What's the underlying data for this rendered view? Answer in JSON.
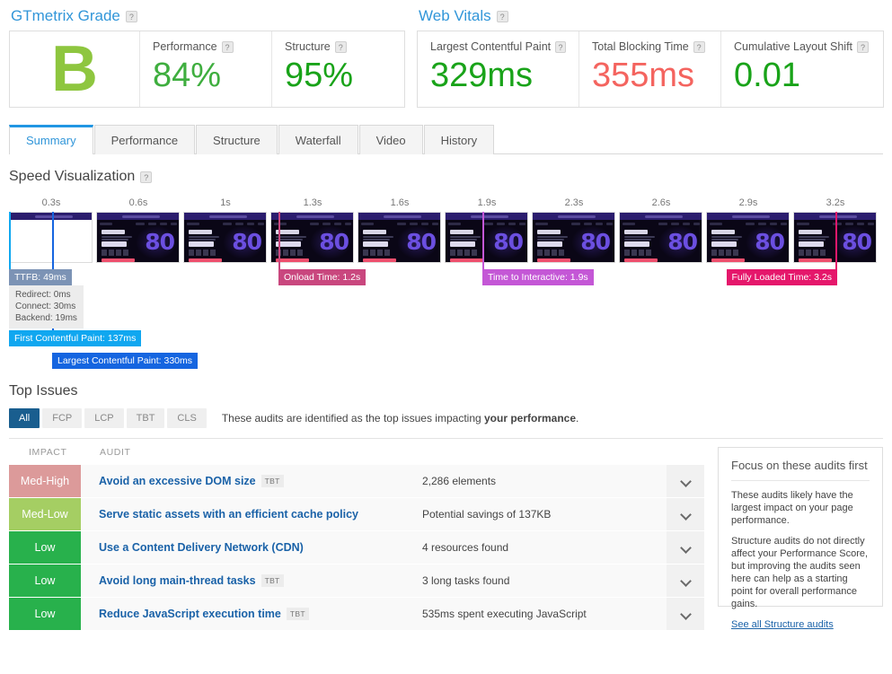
{
  "grade_panel": {
    "title": "GTmetrix Grade",
    "help_icon": "help-icon",
    "grade": "B",
    "grade_color": "#8ec63f",
    "metrics": [
      {
        "label": "Performance",
        "value": "84%",
        "color": "#3fae3f"
      },
      {
        "label": "Structure",
        "value": "95%",
        "color": "#19a319"
      }
    ]
  },
  "web_vitals": {
    "title": "Web Vitals",
    "metrics": [
      {
        "label": "Largest Contentful Paint",
        "value": "329ms",
        "color": "#19a319"
      },
      {
        "label": "Total Blocking Time",
        "value": "355ms",
        "color": "#f4645f"
      },
      {
        "label": "Cumulative Layout Shift",
        "value": "0.01",
        "color": "#19a319"
      }
    ]
  },
  "tabs": [
    {
      "label": "Summary",
      "active": true
    },
    {
      "label": "Performance",
      "active": false
    },
    {
      "label": "Structure",
      "active": false
    },
    {
      "label": "Waterfall",
      "active": false
    },
    {
      "label": "Video",
      "active": false
    },
    {
      "label": "History",
      "active": false
    }
  ],
  "speed_visualization": {
    "title": "Speed Visualization",
    "tick_labels": [
      "0.3s",
      "0.6s",
      "1s",
      "1.3s",
      "1.6s",
      "1.9s",
      "2.3s",
      "2.6s",
      "2.9s",
      "3.2s"
    ],
    "frames": [
      {
        "blank": true
      },
      {
        "blank": false
      },
      {
        "blank": false
      },
      {
        "blank": false
      },
      {
        "blank": false
      },
      {
        "blank": false
      },
      {
        "blank": false
      },
      {
        "blank": false
      },
      {
        "blank": false
      },
      {
        "blank": false
      }
    ],
    "thumbnail_text": "80",
    "markers": [
      {
        "name": "ttfb",
        "label": "TTFB: 49ms",
        "color": "#7c93b5"
      },
      {
        "name": "first-contentful-paint",
        "label": "First Contentful Paint: 137ms",
        "color": "#10a7f0"
      },
      {
        "name": "largest-contentful-paint",
        "label": "Largest Contentful Paint: 330ms",
        "color": "#1565e0"
      },
      {
        "name": "onload",
        "label": "Onload Time: 1.2s",
        "color": "#c9477e"
      },
      {
        "name": "time-to-interactive",
        "label": "Time to Interactive: 1.9s",
        "color": "#c457d6"
      },
      {
        "name": "fully-loaded",
        "label": "Fully Loaded Time: 3.2s",
        "color": "#e5176b"
      }
    ],
    "ttfb_breakdown": [
      "Redirect: 0ms",
      "Connect: 30ms",
      "Backend: 19ms"
    ]
  },
  "top_issues": {
    "title": "Top Issues",
    "filters": [
      {
        "label": "All",
        "active": true
      },
      {
        "label": "FCP",
        "active": false
      },
      {
        "label": "LCP",
        "active": false
      },
      {
        "label": "TBT",
        "active": false
      },
      {
        "label": "CLS",
        "active": false
      }
    ],
    "note_prefix": "These audits are identified as the top issues impacting ",
    "note_bold": "your performance",
    "note_suffix": ".",
    "columns": {
      "impact": "IMPACT",
      "audit": "AUDIT"
    },
    "rows": [
      {
        "impact": "Med-High",
        "impact_color": "#dc9a9a",
        "audit": "Avoid an excessive DOM size",
        "tag": "TBT",
        "value": "2,286 elements"
      },
      {
        "impact": "Med-Low",
        "impact_color": "#a5ce63",
        "audit": "Serve static assets with an efficient cache policy",
        "tag": "",
        "value": "Potential savings of 137KB"
      },
      {
        "impact": "Low",
        "impact_color": "#28b14c",
        "audit": "Use a Content Delivery Network (CDN)",
        "tag": "",
        "value": "4 resources found"
      },
      {
        "impact": "Low",
        "impact_color": "#28b14c",
        "audit": "Avoid long main-thread tasks",
        "tag": "TBT",
        "value": "3 long tasks found"
      },
      {
        "impact": "Low",
        "impact_color": "#28b14c",
        "audit": "Reduce JavaScript execution time",
        "tag": "TBT",
        "value": "535ms spent executing JavaScript"
      }
    ]
  },
  "focus_panel": {
    "title": "Focus on these audits first",
    "paragraph1": "These audits likely have the largest impact on your page performance.",
    "paragraph2": "Structure audits do not directly affect your Performance Score, but improving the audits seen here can help as a starting point for overall performance gains.",
    "link": "See all Structure audits"
  }
}
